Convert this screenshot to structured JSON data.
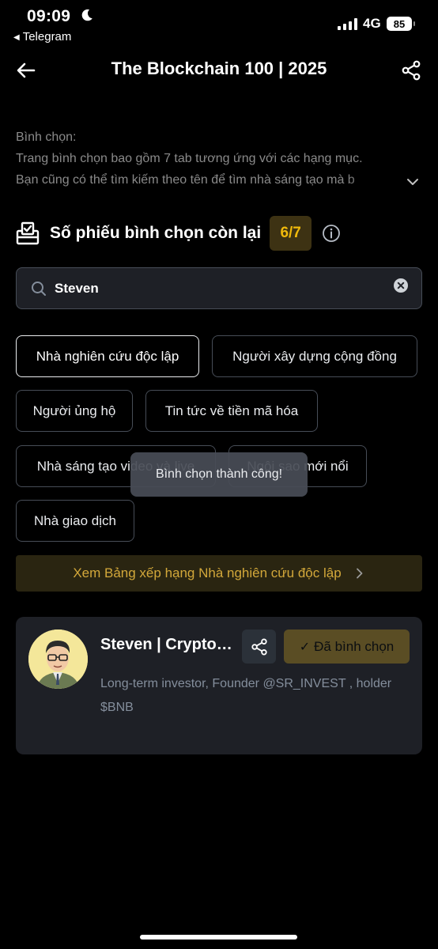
{
  "status": {
    "time": "09:09",
    "back_app": "Telegram",
    "network": "4G",
    "battery": "85"
  },
  "header": {
    "title": "The Blockchain 100 | 2025"
  },
  "description": {
    "heading": "Bình chọn:",
    "line1": "Trang bình chọn bao gồm 7 tab tương ứng với các hạng mục.",
    "line2": "Bạn cũng có thể tìm kiếm theo tên để tìm nhà sáng tạo mà b"
  },
  "votes": {
    "label": "Số phiếu bình chọn còn lại",
    "remaining": "6/7"
  },
  "search": {
    "value": "Steven"
  },
  "categories": [
    {
      "label": "Nhà nghiên cứu độc lập",
      "active": true
    },
    {
      "label": "Người xây dựng cộng đồng",
      "active": false
    },
    {
      "label": "Người ủng hộ",
      "active": false
    },
    {
      "label": "Tin tức về tiền mã hóa",
      "active": false
    },
    {
      "label": "Nhà sáng tạo video và live",
      "active": false
    },
    {
      "label": "Ngôi sao mới nổi",
      "active": false
    },
    {
      "label": "Nhà giao dịch",
      "active": false
    }
  ],
  "toast": {
    "message": "Bình chọn thành công!"
  },
  "ranking_banner": {
    "label": "Xem Bảng xếp hạng Nhà nghiên cứu độc lập"
  },
  "candidate": {
    "name": "Steven | CryptoSR",
    "voted_label": "Đã bình chọn",
    "bio": "Long-term investor, Founder @SR_INVEST , holder $BNB"
  },
  "colors": {
    "accent": "#f0b90b",
    "background": "#000000",
    "card": "#1e2026"
  }
}
